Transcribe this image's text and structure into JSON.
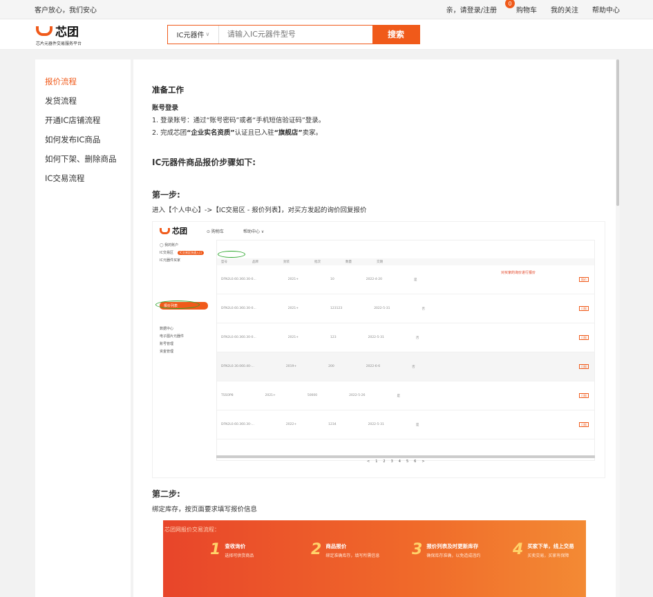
{
  "topbar": {
    "slogan": "客户放心，我们安心",
    "login": "亲，请登录/注册",
    "cart_count": "0",
    "cart": "购物车",
    "follow": "我的关注",
    "help": "帮助中心"
  },
  "header": {
    "logo_name": "芯团",
    "logo_sub": "芯片元器件交易服务平台",
    "search_category": "IC元器件",
    "search_placeholder": "请输入IC元器件型号",
    "search_button": "搜索"
  },
  "sidebar": {
    "items": [
      {
        "label": "报价流程"
      },
      {
        "label": "发货流程"
      },
      {
        "label": "开通IC店铺流程"
      },
      {
        "label": "如何发布IC商品"
      },
      {
        "label": "如何下架、删除商品"
      },
      {
        "label": "IC交易流程"
      }
    ]
  },
  "main": {
    "prep_title": "准备工作",
    "account_title": "账号登录",
    "line1": "1. 登录账号：通过“账号密码”或者“手机短信验证码”登录。",
    "line2_pre": "2. 完成芯团",
    "line2_b1": "“企业实名资质”",
    "line2_mid": "认证且已入驻",
    "line2_b2": "“旗舰店”",
    "line2_post": "卖家。",
    "steps_title": "IC元器件商品报价步骤如下:",
    "step1_title": "第一步:",
    "step1_desc": "进入【个人中心】->【IC交易区 - 报价列表】，对买方发起的询价回复报价",
    "step2_title": "第二步:",
    "step2_desc": "绑定库存，按页面要求填写报价信息"
  },
  "screenshot": {
    "logo": "芯团",
    "nav1": "⊙ 购物车",
    "nav2": "帮助中心 ∨",
    "left_items": [
      "◯ 我的账户",
      "IC交易区",
      "IC元器件买家",
      "报价列表",
      "数据中心",
      "电子图片元器件",
      "账号管理",
      "资金管理"
    ],
    "tag": "IC交易区快速入口",
    "annotation": "对买家的询价进行报价",
    "pager": [
      "<",
      "1",
      "2",
      "3",
      "4",
      "5",
      "6",
      ">"
    ],
    "rows": [
      [
        "DFN2L0.60.360.30-0...",
        "2021+",
        "10",
        "2022-4-20",
        "是"
      ],
      [
        "DFN2L0.60.360.30-0...",
        "2021+",
        "123123",
        "2022-5-31",
        "否"
      ],
      [
        "DFN2L0.60.360.30-0...",
        "2021+",
        "123",
        "2022-5-31",
        "否"
      ],
      [
        "DFN2L0.30.060.40-...",
        "2019+",
        "200",
        "2022-6-6",
        "否"
      ],
      [
        "TSSOP8",
        "2021+",
        "50000",
        "2022-5-26",
        "是"
      ],
      [
        "DFN2L0.60.360.30-...",
        "2022+",
        "1234",
        "2022-5-31",
        "是"
      ],
      [
        "DFN2L0.60.360.30-...",
        "2022+",
        "1234",
        "2022-5-31",
        "否"
      ]
    ]
  },
  "banner": {
    "title": "芯团网报价交易流程：",
    "steps": [
      {
        "num": "1",
        "title": "查收询价",
        "desc": "选择可供货商品"
      },
      {
        "num": "2",
        "title": "商品报价",
        "desc": "绑定准确库存，填写所需信息"
      },
      {
        "num": "3",
        "title": "报价列表及时更新库存",
        "desc": "确保库存准确，以免造成违约"
      },
      {
        "num": "4",
        "title": "买家下单，线上交易",
        "desc": "买卖交易，买家有保障"
      }
    ]
  }
}
